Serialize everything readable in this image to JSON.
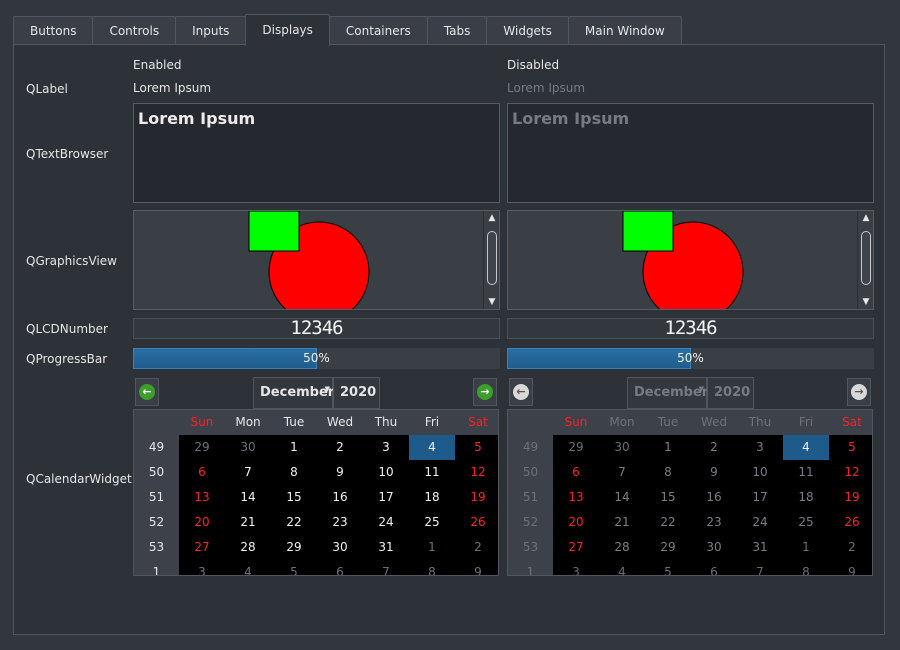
{
  "tabs": [
    "Buttons",
    "Controls",
    "Inputs",
    "Displays",
    "Containers",
    "Tabs",
    "Widgets",
    "Main Window"
  ],
  "active_tab": "Displays",
  "columns": {
    "enabled": "Enabled",
    "disabled": "Disabled"
  },
  "rows": {
    "qlabel": "QLabel",
    "qtextbrowser": "QTextBrowser",
    "qgraphicsview": "QGraphicsView",
    "qlcdnumber": "QLCDNumber",
    "qprogressbar": "QProgressBar",
    "qcalendar": "QCalendarWidget"
  },
  "label_text": "Lorem Ipsum",
  "textbrowser_text": "Lorem Ipsum",
  "lcd_value": "12346",
  "progress": {
    "value": 0.5,
    "text": "50%"
  },
  "colors": {
    "circle": "#ff0000",
    "square": "#00ff00",
    "accent": "#1e5a8a",
    "weekend": "#ff2020"
  },
  "calendar": {
    "month": "December",
    "year": "2020",
    "prev_icon": "left-arrow-icon",
    "next_icon": "right-arrow-icon",
    "weekdays": [
      "Sun",
      "Mon",
      "Tue",
      "Wed",
      "Thu",
      "Fri",
      "Sat"
    ],
    "weeks": [
      {
        "num": "49",
        "days": [
          "29",
          "30",
          "1",
          "2",
          "3",
          "4",
          "5"
        ]
      },
      {
        "num": "50",
        "days": [
          "6",
          "7",
          "8",
          "9",
          "10",
          "11",
          "12"
        ]
      },
      {
        "num": "51",
        "days": [
          "13",
          "14",
          "15",
          "16",
          "17",
          "18",
          "19"
        ]
      },
      {
        "num": "52",
        "days": [
          "20",
          "21",
          "22",
          "23",
          "24",
          "25",
          "26"
        ]
      },
      {
        "num": "53",
        "days": [
          "27",
          "28",
          "29",
          "30",
          "31",
          "1",
          "2"
        ]
      },
      {
        "num": "1",
        "days": [
          "3",
          "4",
          "5",
          "6",
          "7",
          "8",
          "9"
        ]
      }
    ],
    "selected": "4"
  }
}
